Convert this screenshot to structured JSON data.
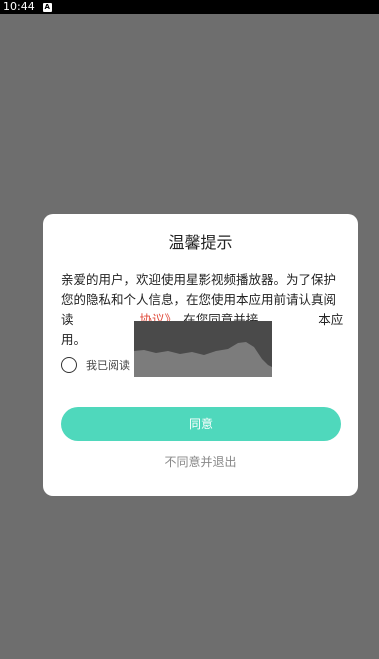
{
  "status_bar": {
    "time": "10:44",
    "notification_icon": "A"
  },
  "dialog": {
    "title": "温馨提示",
    "body_line1": "亲爱的用户，欢迎使用星影视频播放器。为了保护您的隐私和个人信息，在您使用本应用前请认真阅读",
    "body_link": "协议》",
    "body_line2": "，在您同意并接",
    "body_end": "本应用。",
    "checkbox_label": "我已阅读",
    "agree_label": "同意",
    "decline_label": "不同意并退出",
    "link_color": "#e04a3a",
    "accent_color": "#4fd8bc"
  }
}
